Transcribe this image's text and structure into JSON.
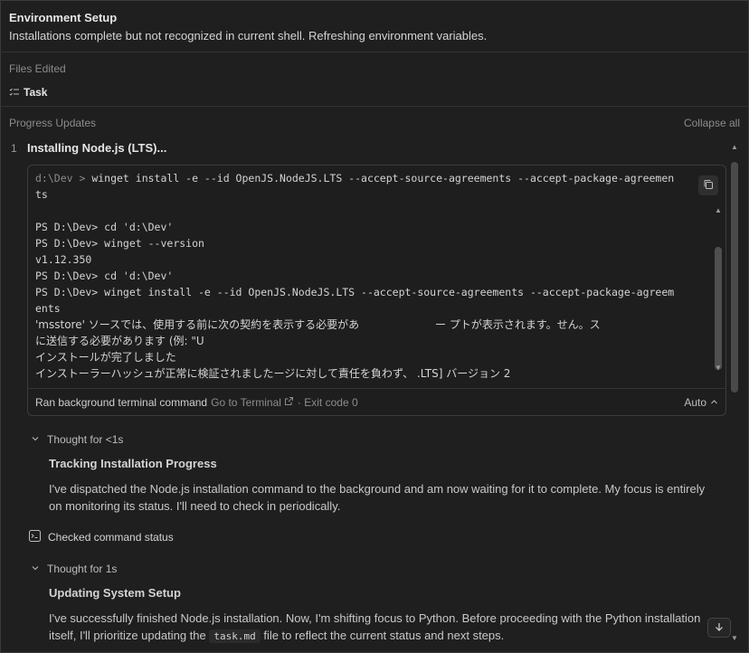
{
  "header": {
    "title": "Environment Setup",
    "description": "Installations complete but not recognized in current shell. Refreshing environment variables."
  },
  "files_edited": {
    "label": "Files Edited",
    "items": [
      {
        "name": "Task",
        "icon": "checklist-icon"
      }
    ]
  },
  "progress": {
    "label": "Progress Updates",
    "collapse_label": "Collapse all",
    "step": {
      "number": "1",
      "title": "Installing Node.js (LTS)..."
    }
  },
  "terminal": {
    "prompt_dim": "d:\\Dev > ",
    "lines": [
      "winget install -e --id OpenJS.NodeJS.LTS --accept-source-agreements --accept-package-agreemen",
      "ts",
      "",
      "PS D:\\Dev> cd 'd:\\Dev'",
      "PS D:\\Dev> winget --version",
      "v1.12.350",
      "PS D:\\Dev> cd 'd:\\Dev'",
      "PS D:\\Dev> winget install -e --id OpenJS.NodeJS.LTS --accept-source-agreements --accept-package-agreem",
      "ents",
      "'msstore' ソースでは、使用する前に次の契約を表示する必要があ                      ー プトが表示されます。せん。ス",
      "に送信する必要があります (例: \"U",
      "インストールが完了しました",
      "インストーラーハッシュが正常に検証されましたージに対して責任を負わず、 .LTS] バージョン 2"
    ],
    "footer": {
      "ran_label": "Ran background terminal command",
      "goto_label": "Go to Terminal",
      "exit_label": "· Exit code 0",
      "auto_label": "Auto"
    }
  },
  "thoughts": [
    {
      "label": "Thought for <1s",
      "title": "Tracking Installation Progress",
      "text": "I've dispatched the Node.js installation command to the background and am now waiting for it to complete. My focus is entirely on monitoring its status. I'll need to check in periodically."
    },
    {
      "label": "Thought for 1s",
      "title": "Updating System Setup",
      "text_before": "I've successfully finished Node.js installation. Now, I'm shifting focus to Python. Before proceeding with the Python installation itself, I'll prioritize updating the ",
      "code": "task.md",
      "text_after": " file to reflect the current status and next steps."
    }
  ],
  "checked": {
    "label": "Checked command status"
  },
  "colors": {
    "background": "#1f1f1f",
    "border": "#333333",
    "text": "#cccccc",
    "muted": "#8c8c8c"
  }
}
